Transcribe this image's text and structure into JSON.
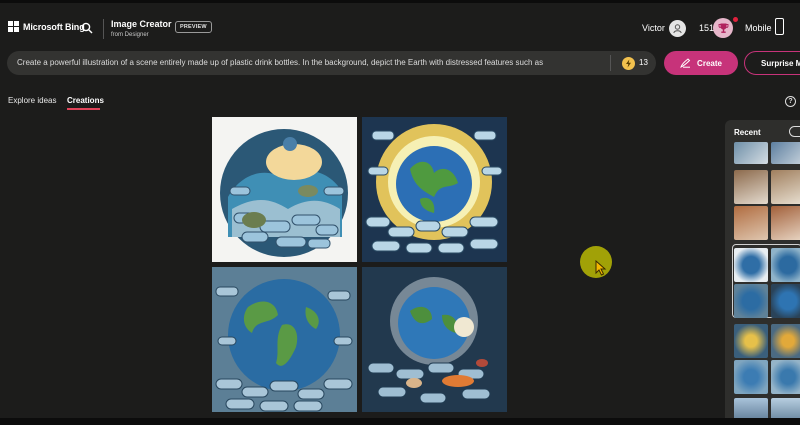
{
  "header": {
    "brand": "Microsoft Bing",
    "app_title": "Image Creator",
    "app_subtitle": "from Designer",
    "badge": "PREVIEW",
    "user_name": "Victor",
    "points": "151",
    "mobile_label": "Mobile"
  },
  "prompt": {
    "value": "Create a powerful illustration of a scene entirely made up of plastic drink bottles. In the background, depict the Earth with distressed features such as",
    "boost_count": "13",
    "create_label": "Create",
    "surprise_label": "Surprise Me"
  },
  "tabs": [
    {
      "label": "Explore ideas",
      "active": false
    },
    {
      "label": "Creations",
      "active": true
    }
  ],
  "help_icon": "?",
  "recent": {
    "title": "Recent",
    "thumbnail_groups": 5
  },
  "icons": [
    "microsoft-logo-icon",
    "search-icon",
    "avatar-icon",
    "trophy-icon",
    "phone-icon",
    "boost-icon",
    "create-pen-icon",
    "help-icon",
    "toggle-icon",
    "mouse-cursor-icon"
  ],
  "colors": {
    "accent": "#c7337a",
    "background": "#1c1c1b",
    "prompt_bg": "#333331",
    "boost": "#f2c14e",
    "tab_underline": "#e0445a"
  }
}
